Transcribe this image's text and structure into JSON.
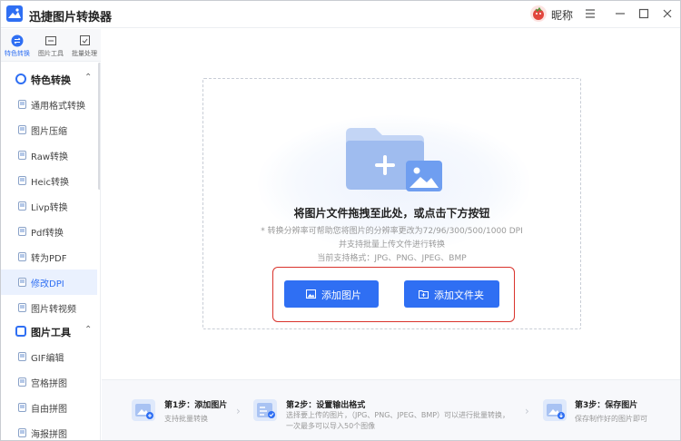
{
  "app": {
    "title": "迅捷图片转换器"
  },
  "user": {
    "nickname": "昵称"
  },
  "window_controls": [
    "menu-icon",
    "minimize-icon",
    "maximize-icon",
    "close-icon"
  ],
  "rail": {
    "tabs": [
      {
        "label": "特色转换",
        "icon": "convert-icon",
        "active": true
      },
      {
        "label": "图片工具",
        "icon": "image-tools-icon",
        "active": false
      },
      {
        "label": "批量处理",
        "icon": "batch-icon",
        "active": false
      }
    ]
  },
  "sidebar": {
    "section1": {
      "title": "特色转换",
      "icon": "convert-circle-icon",
      "expanded": true
    },
    "items": [
      {
        "label": "通用格式转换"
      },
      {
        "label": "图片压缩"
      },
      {
        "label": "Raw转换"
      },
      {
        "label": "Heic转换"
      },
      {
        "label": "Livp转换"
      },
      {
        "label": "Pdf转换"
      },
      {
        "label": "转为PDF"
      },
      {
        "label": "修改DPI",
        "active": true
      },
      {
        "label": "图片转视频"
      }
    ],
    "section2": {
      "title": "图片工具",
      "icon": "image-tools-icon"
    },
    "items2": [
      {
        "label": "GIF编辑"
      },
      {
        "label": "宫格拼图"
      },
      {
        "label": "自由拼图"
      },
      {
        "label": "海报拼图"
      }
    ]
  },
  "dropzone": {
    "title": "将图片文件拖拽至此处，或点击下方按钮",
    "line1": "* 转换分辨率可帮助您将图片的分辨率更改为72/96/300/500/1000 DPI",
    "line2": "并支持批量上传文件进行转换",
    "line3": "当前支持格式：JPG、PNG、JPEG、BMP",
    "add_image_label": "添加图片",
    "add_folder_label": "添加文件夹"
  },
  "steps": [
    {
      "title": "第1步：添加图片",
      "desc": [
        "支持批量转换"
      ]
    },
    {
      "title": "第2步：设置输出格式",
      "desc": [
        "选择要上传的图片，（JPG、PNG、JPEG、BMP）可以进行批量转换，",
        "一次最多可以导入50个图像"
      ]
    },
    {
      "title": "第3步：保存图片",
      "desc": [
        "保存制作好的图片即可"
      ]
    }
  ],
  "colors": {
    "accent": "#2f6ff3",
    "highlight_frame": "#d9332c",
    "active_bg": "#eaf1fe"
  }
}
